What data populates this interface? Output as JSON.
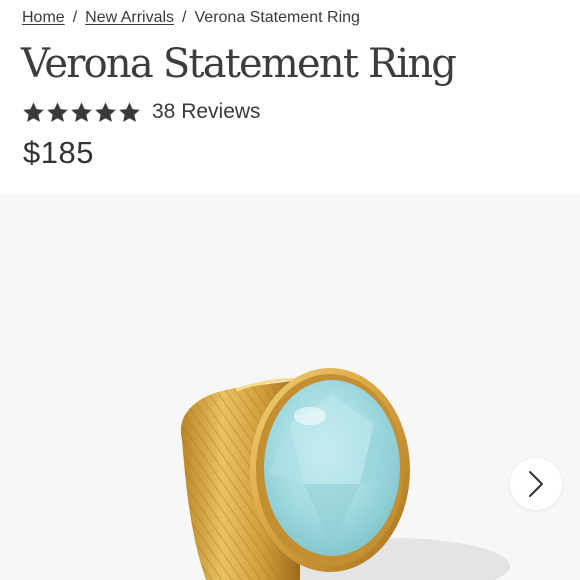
{
  "breadcrumb": {
    "items": [
      {
        "label": "Home"
      },
      {
        "label": "New Arrivals"
      },
      {
        "label": "Verona Statement Ring"
      }
    ],
    "separator": "/"
  },
  "product": {
    "title": "Verona Statement Ring",
    "rating": 5,
    "rating_max": 5,
    "reviews_label": "38 Reviews",
    "price": "$185"
  },
  "gallery": {
    "image_icon": "ring-with-blue-stone-icon",
    "next_icon": "chevron-right-icon"
  },
  "colors": {
    "text": "#3a3a3a",
    "star": "#3a3a3a",
    "gallery_background": "#f7f7f7",
    "gold": "#d9a441",
    "stone": "#a6dde2"
  }
}
